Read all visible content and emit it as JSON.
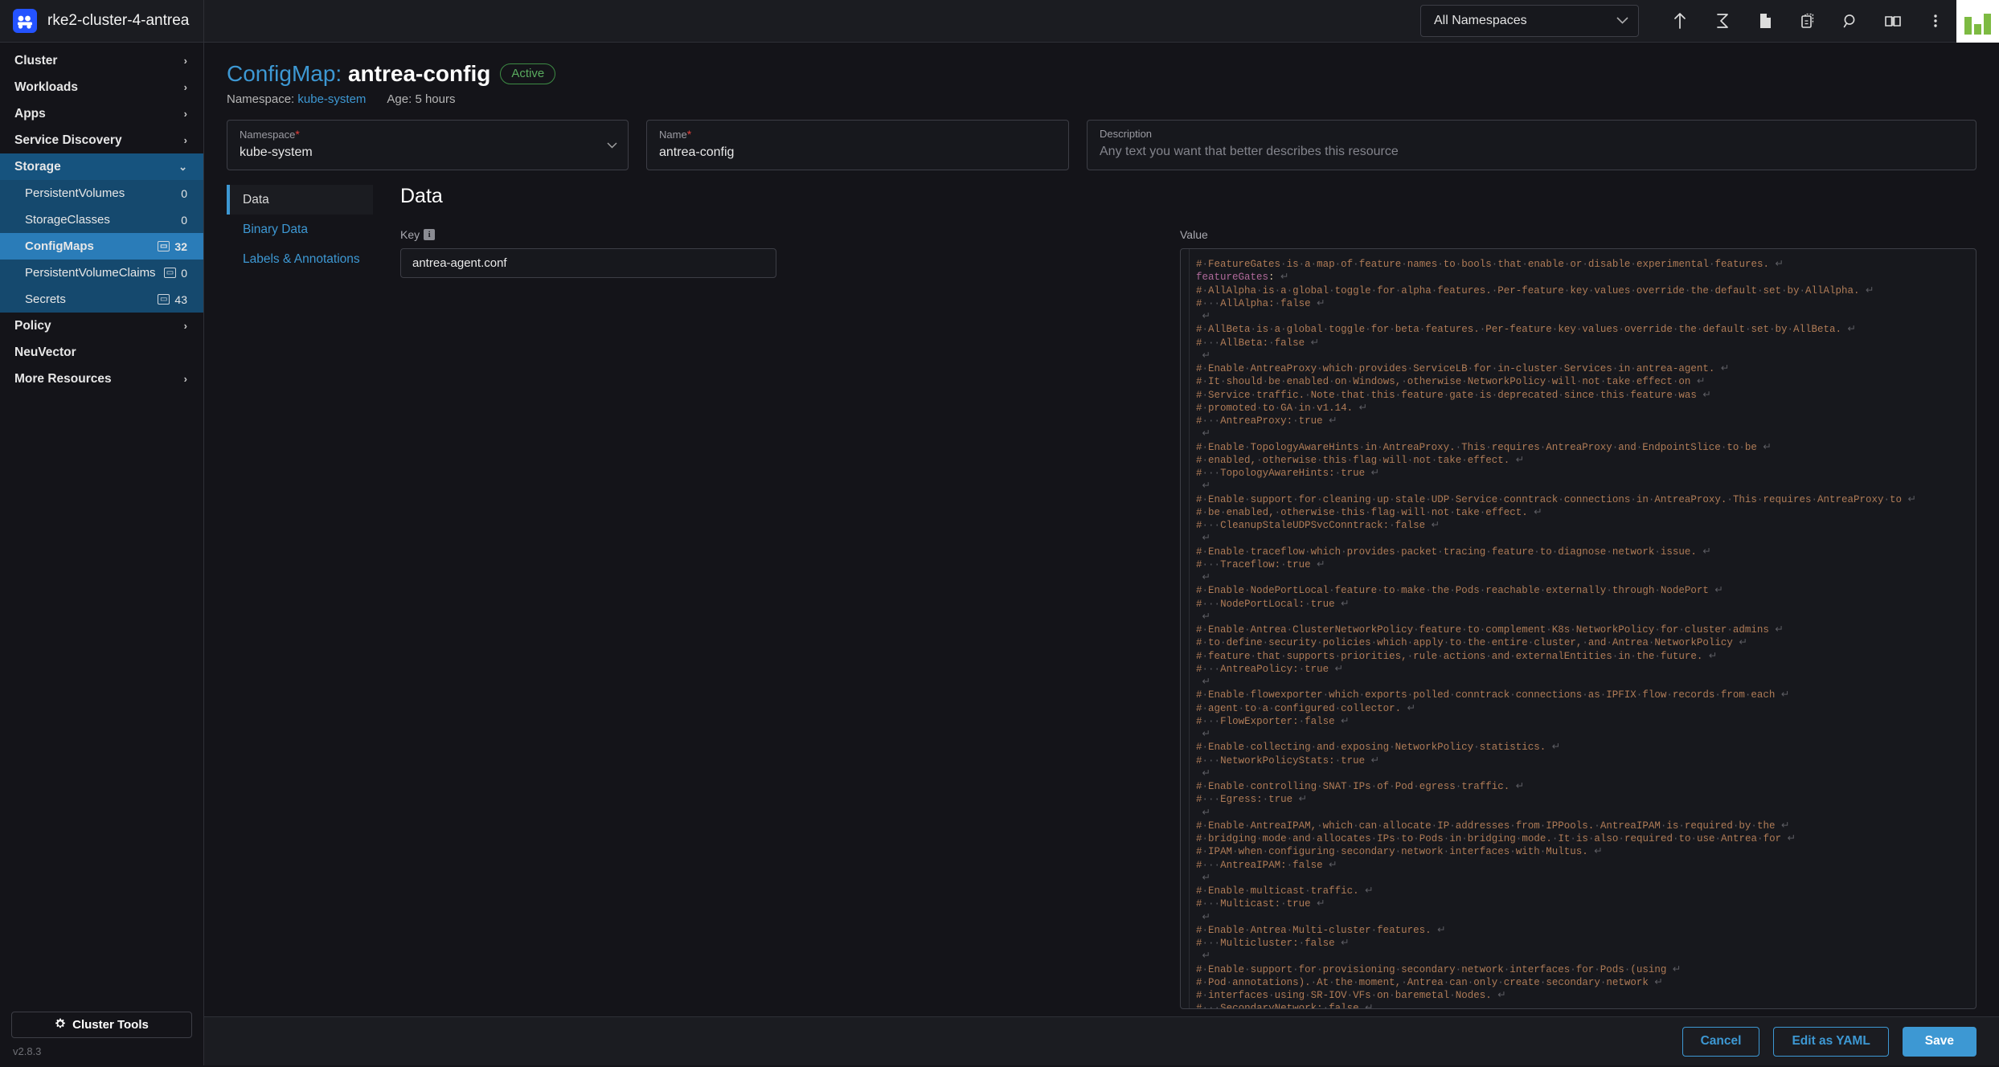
{
  "topbar": {
    "cluster_name": "rke2-cluster-4-antrea",
    "namespace_filter": "All Namespaces",
    "icons": [
      {
        "name": "import-yaml-icon",
        "glyph": "↑"
      },
      {
        "name": "kubectl-shell-icon",
        "glyph": "≥"
      },
      {
        "name": "notes-icon",
        "glyph": "⬜"
      },
      {
        "name": "copy-kubeconfig-icon",
        "glyph": "⧉"
      },
      {
        "name": "search-icon",
        "glyph": "⌕"
      },
      {
        "name": "docs-icon",
        "glyph": "☷"
      },
      {
        "name": "kebab-menu-icon",
        "glyph": "⋮"
      }
    ]
  },
  "sidebar": {
    "groups": [
      {
        "label": "Cluster",
        "expanded": false,
        "chevron": "›",
        "children": []
      },
      {
        "label": "Workloads",
        "expanded": false,
        "chevron": "›",
        "children": []
      },
      {
        "label": "Apps",
        "expanded": false,
        "chevron": "›",
        "children": []
      },
      {
        "label": "Service Discovery",
        "expanded": false,
        "chevron": "›",
        "children": []
      },
      {
        "label": "Storage",
        "expanded": true,
        "chevron": "⌄",
        "children": [
          {
            "label": "PersistentVolumes",
            "count": "0",
            "badge": false,
            "active": false
          },
          {
            "label": "StorageClasses",
            "count": "0",
            "badge": false,
            "active": false
          },
          {
            "label": "ConfigMaps",
            "count": "32",
            "badge": true,
            "active": true
          },
          {
            "label": "PersistentVolumeClaims",
            "count": "0",
            "badge": true,
            "active": false
          },
          {
            "label": "Secrets",
            "count": "43",
            "badge": true,
            "active": false
          }
        ]
      },
      {
        "label": "Policy",
        "expanded": false,
        "chevron": "›",
        "children": []
      },
      {
        "label": "NeuVector",
        "expanded": false,
        "chevron": "",
        "children": []
      },
      {
        "label": "More Resources",
        "expanded": false,
        "chevron": "›",
        "children": []
      }
    ],
    "cluster_tools_label": "Cluster Tools",
    "version": "v2.8.3"
  },
  "header": {
    "kind_prefix": "ConfigMap:",
    "resource_name": "antrea-config",
    "status": "Active",
    "namespace_label": "Namespace:",
    "namespace_value": "kube-system",
    "age_label": "Age:",
    "age_value": "5 hours"
  },
  "form": {
    "namespace": {
      "label": "Namespace",
      "required": "*",
      "value": "kube-system",
      "chevron": "⌄"
    },
    "name": {
      "label": "Name",
      "required": "*",
      "value": "antrea-config"
    },
    "description": {
      "label": "Description",
      "placeholder": "Any text you want that better describes this resource"
    }
  },
  "tabs": [
    {
      "label": "Data",
      "active": true
    },
    {
      "label": "Binary Data",
      "active": false
    },
    {
      "label": "Labels & Annotations",
      "active": false
    }
  ],
  "panel": {
    "heading": "Data",
    "key_label": "Key",
    "value_label": "Value",
    "key_value": "antrea-agent.conf"
  },
  "footer": {
    "cancel": "Cancel",
    "edit_yaml": "Edit as YAML",
    "save": "Save"
  },
  "code": {
    "lines": [
      "# FeatureGates is a map of feature names to bools that enable or disable experimental features.",
      "featureGates:",
      "# AllAlpha is a global toggle for alpha features. Per-feature key values override the default set by AllAlpha.",
      "#   AllAlpha: false",
      "",
      "# AllBeta is a global toggle for beta features. Per-feature key values override the default set by AllBeta.",
      "#   AllBeta: false",
      "",
      "# Enable AntreaProxy which provides ServiceLB for in-cluster Services in antrea-agent.",
      "# It should be enabled on Windows, otherwise NetworkPolicy will not take effect on",
      "# Service traffic. Note that this feature gate is deprecated since this feature was",
      "# promoted to GA in v1.14.",
      "#   AntreaProxy: true",
      "",
      "# Enable TopologyAwareHints in AntreaProxy. This requires AntreaProxy and EndpointSlice to be",
      "# enabled, otherwise this flag will not take effect.",
      "#   TopologyAwareHints: true",
      "",
      "# Enable support for cleaning up stale UDP Service conntrack connections in AntreaProxy. This requires AntreaProxy to",
      "# be enabled, otherwise this flag will not take effect.",
      "#   CleanupStaleUDPSvcConntrack: false",
      "",
      "# Enable traceflow which provides packet tracing feature to diagnose network issue.",
      "#   Traceflow: true",
      "",
      "# Enable NodePortLocal feature to make the Pods reachable externally through NodePort",
      "#   NodePortLocal: true",
      "",
      "# Enable Antrea ClusterNetworkPolicy feature to complement K8s NetworkPolicy for cluster admins",
      "# to define security policies which apply to the entire cluster, and Antrea NetworkPolicy",
      "# feature that supports priorities, rule actions and externalEntities in the future.",
      "#   AntreaPolicy: true",
      "",
      "# Enable flowexporter which exports polled conntrack connections as IPFIX flow records from each",
      "# agent to a configured collector.",
      "#   FlowExporter: false",
      "",
      "# Enable collecting and exposing NetworkPolicy statistics.",
      "#   NetworkPolicyStats: true",
      "",
      "# Enable controlling SNAT IPs of Pod egress traffic.",
      "#   Egress: true",
      "",
      "# Enable AntreaIPAM, which can allocate IP addresses from IPPools. AntreaIPAM is required by the",
      "# bridging mode and allocates IPs to Pods in bridging mode. It is also required to use Antrea for",
      "# IPAM when configuring secondary network interfaces with Multus.",
      "#   AntreaIPAM: false",
      "",
      "# Enable multicast traffic.",
      "#   Multicast: true",
      "",
      "# Enable Antrea Multi-cluster features.",
      "#   Multicluster: false",
      "",
      "# Enable support for provisioning secondary network interfaces for Pods (using",
      "# Pod annotations). At the moment, Antrea can only create secondary network",
      "# interfaces using SR-IOV VFs on baremetal Nodes.",
      "#   SecondaryNetwork: false"
    ]
  },
  "colors": {
    "accent": "#3d98d3",
    "nav_active": "#2a7cb8",
    "nav_group_expanded": "#16537e",
    "status_green": "#5aab5f",
    "code_comment": "#b07c57",
    "code_key": "#b06a9b",
    "brand_blue": "#2453ff",
    "rancher_green": "#7dba42"
  }
}
